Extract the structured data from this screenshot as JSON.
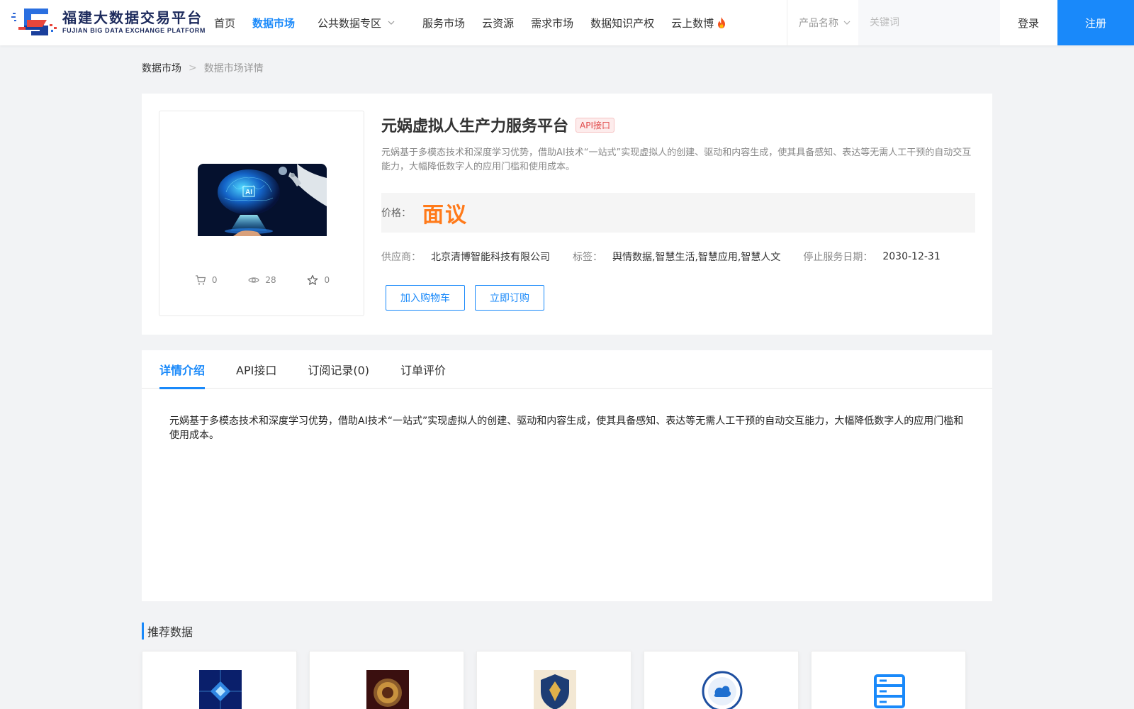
{
  "header": {
    "logo_cn": "福建大数据交易平台",
    "logo_en": "FUJIAN BIG DATA EXCHANGE PLATFORM",
    "nav": [
      {
        "label": "首页",
        "active": false
      },
      {
        "label": "数据市场",
        "active": true
      },
      {
        "label": "公共数据专区",
        "active": false,
        "dropdown": true
      },
      {
        "label": "服务市场",
        "active": false
      },
      {
        "label": "云资源",
        "active": false
      },
      {
        "label": "需求市场",
        "active": false
      },
      {
        "label": "数据知识产权",
        "active": false
      },
      {
        "label": "云上数博",
        "active": false,
        "icon": "fire-icon"
      }
    ],
    "search": {
      "select_value": "产品名称",
      "placeholder": "关键词"
    },
    "login_label": "登录",
    "register_label": "注册"
  },
  "breadcrumb": {
    "root": "数据市场",
    "separator": ">",
    "current": "数据市场详情"
  },
  "product": {
    "title": "元娲虚拟人生产力服务平台",
    "badge": "API接口",
    "description": "元娲基于多模态技术和深度学习优势，借助AI技术“一站式”实现虚拟人的创建、驱动和内容生成，使其具备感知、表达等无需人工干预的自动交互能力，大幅降低数字人的应用门槛和使用成本。",
    "price_label": "价格：",
    "price_value": "面议",
    "supplier_label": "供应商：",
    "supplier": "北京清博智能科技有限公司",
    "tags_label": "标签：",
    "tags": "舆情数据,智慧生活,智慧应用,智慧人文",
    "end_date_label": "停止服务日期：",
    "end_date": "2030-12-31",
    "stats": {
      "cart": "0",
      "views": "28",
      "favorites": "0"
    },
    "add_cart_label": "加入购物车",
    "buy_label": "立即订购"
  },
  "tabs": [
    {
      "label": "详情介绍",
      "active": true
    },
    {
      "label": "API接口",
      "active": false
    },
    {
      "label": "订阅记录(0)",
      "active": false
    },
    {
      "label": "订单评价",
      "active": false
    }
  ],
  "detail_text": "元娲基于多模态技术和深度学习优势，借助AI技术“一站式”实现虚拟人的创建、驱动和内容生成，使其具备感知、表达等无需人工干预的自动交互能力，大幅降低数字人的应用门槛和使用成本。",
  "recommend": {
    "title": "推荐数据",
    "items": [
      {
        "icon": "chip-icon"
      },
      {
        "icon": "coin-icon"
      },
      {
        "icon": "shield-icon"
      },
      {
        "icon": "weather-seal-icon"
      },
      {
        "icon": "server-icon"
      }
    ]
  },
  "colors": {
    "accent": "#1989fa",
    "price": "#ff7a1a",
    "badge": "#e04848"
  }
}
